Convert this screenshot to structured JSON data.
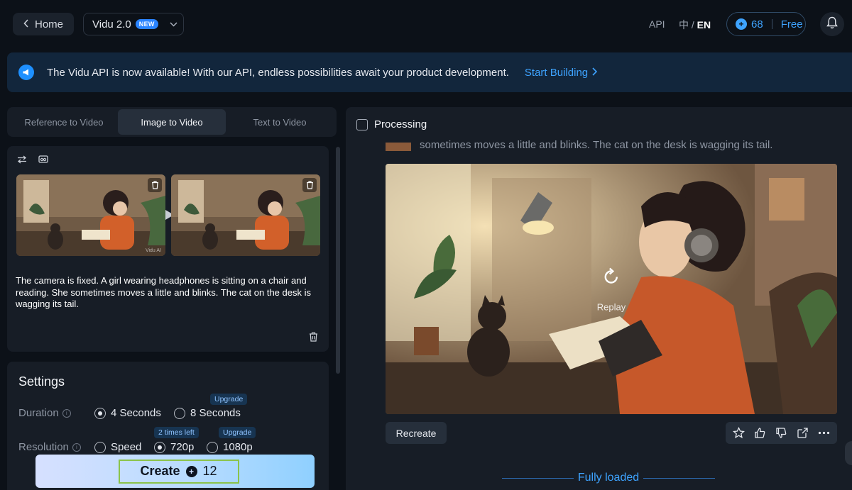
{
  "header": {
    "home_label": "Home",
    "model_name": "Vidu 2.0",
    "model_badge": "NEW",
    "api_label": "API",
    "lang_zh": "中",
    "lang_sep": "/",
    "lang_en": "EN",
    "credits_value": "68",
    "plan_label": "Free"
  },
  "banner": {
    "message": "The Vidu API is now available! With our API, endless possibilities await your product development.",
    "cta": "Start Building"
  },
  "tabs": [
    {
      "label": "Reference to Video",
      "active": false
    },
    {
      "label": "Image to Video",
      "active": true
    },
    {
      "label": "Text to Video",
      "active": false
    }
  ],
  "input": {
    "prompt": "The camera is fixed. A girl wearing headphones is sitting on a chair and reading. She sometimes moves a little and blinks. The cat on the desk is wagging its tail.",
    "watermark": "Vidu AI"
  },
  "settings": {
    "title": "Settings",
    "duration_label": "Duration",
    "duration_options": [
      {
        "label": "4 Seconds",
        "selected": true
      },
      {
        "label": "8 Seconds",
        "selected": false,
        "tag": "Upgrade"
      }
    ],
    "resolution_label": "Resolution",
    "resolution_options": [
      {
        "label": "Speed",
        "selected": false
      },
      {
        "label": "720p",
        "selected": true,
        "tag": "2 times left"
      },
      {
        "label": "1080p",
        "selected": false,
        "tag": "Upgrade"
      }
    ]
  },
  "create": {
    "label": "Create",
    "cost": "12"
  },
  "result": {
    "status": "Processing",
    "prev_prompt": "sometimes moves a little and blinks. The cat on the desk is wagging its tail.",
    "replay_label": "Replay",
    "recreate_label": "Recreate",
    "footer": "Fully loaded"
  },
  "colors": {
    "accent": "#3ea3ff",
    "background": "#0c1118",
    "panel": "#171d26",
    "create_border": "#8bc34a"
  }
}
